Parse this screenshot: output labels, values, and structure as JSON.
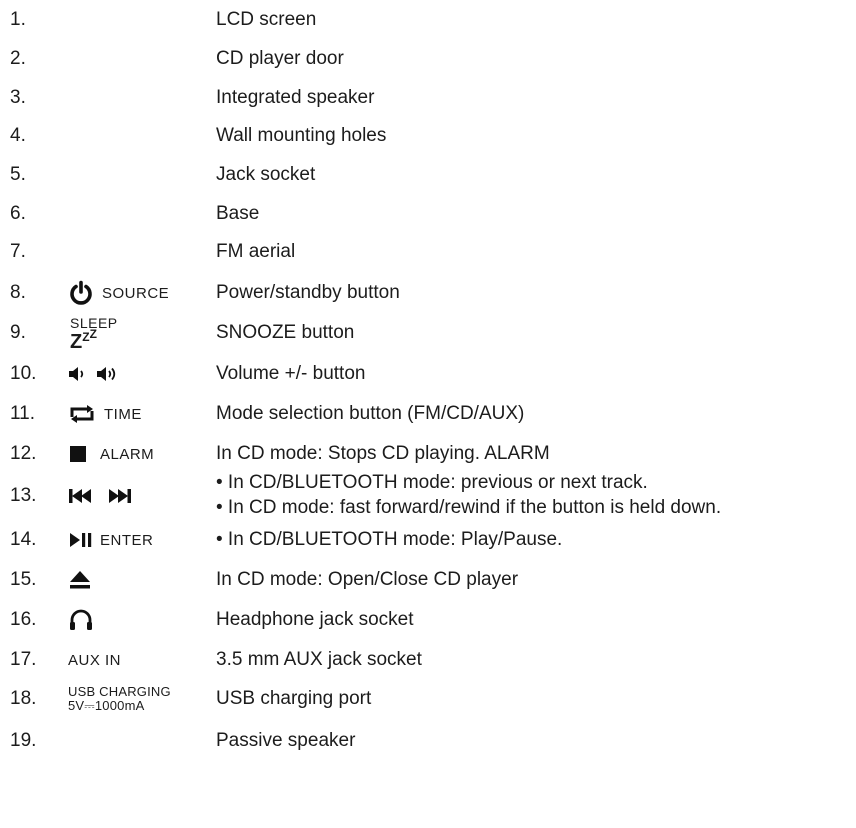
{
  "items": [
    {
      "num": "1.",
      "desc": "LCD screen"
    },
    {
      "num": "2.",
      "desc": "CD player door"
    },
    {
      "num": "3.",
      "desc": "Integrated speaker"
    },
    {
      "num": "4.",
      "desc": "Wall mounting holes"
    },
    {
      "num": "5.",
      "desc": "Jack socket"
    },
    {
      "num": "6.",
      "desc": "Base"
    },
    {
      "num": "7.",
      "desc": "FM aerial"
    },
    {
      "num": "8.",
      "desc": "Power/standby button",
      "label": "SOURCE",
      "icon": "power-icon"
    },
    {
      "num": "9.",
      "desc": "SNOOZE button",
      "label": "SLEEP",
      "label2": "Z",
      "icon": "sleep-zzz-icon"
    },
    {
      "num": "10.",
      "desc": "Volume +/- button",
      "icon": "volume-icons"
    },
    {
      "num": "11.",
      "desc": "Mode selection button (FM/CD/AUX)",
      "label": "TIME",
      "icon": "repeat-icon"
    },
    {
      "num": "12.",
      "desc": "In CD mode: Stops CD playing. ALARM",
      "label": "ALARM",
      "icon": "stop-icon"
    },
    {
      "num": "13.",
      "desc": "• In CD/BLUETOOTH mode: previous or next track.",
      "desc2": "• In CD mode: fast forward/rewind if the button is held down.",
      "icon": "skip-icons"
    },
    {
      "num": "14.",
      "desc": "• In CD/BLUETOOTH mode: Play/Pause.",
      "label": "ENTER",
      "icon": "play-pause-icon"
    },
    {
      "num": "15.",
      "desc": "In CD mode: Open/Close CD player",
      "icon": "eject-icon"
    },
    {
      "num": "16.",
      "desc": "Headphone jack socket",
      "icon": "headphone-icon"
    },
    {
      "num": "17.",
      "desc": "3.5 mm AUX jack socket",
      "label": "AUX IN"
    },
    {
      "num": "18.",
      "desc": "USB charging port",
      "label": "USB CHARGING",
      "label2": "5V⎓1000mA"
    },
    {
      "num": "19.",
      "desc": "Passive speaker"
    }
  ]
}
